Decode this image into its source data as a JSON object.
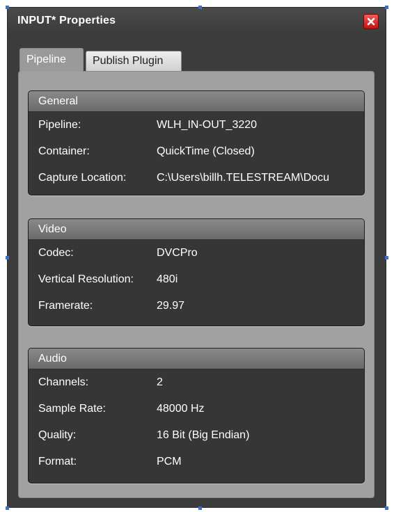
{
  "window": {
    "title": "INPUT* Properties"
  },
  "tabs": [
    {
      "label": "Pipeline",
      "active": true
    },
    {
      "label": "Publish Plugin",
      "active": false
    }
  ],
  "groups": {
    "general": {
      "header": "General",
      "rows": [
        {
          "label": "Pipeline:",
          "value": "WLH_IN-OUT_3220"
        },
        {
          "label": "Container:",
          "value": "QuickTime (Closed)"
        },
        {
          "label": "Capture Location:",
          "value": "C:\\Users\\billh.TELESTREAM\\Docu"
        }
      ]
    },
    "video": {
      "header": "Video",
      "rows": [
        {
          "label": "Codec:",
          "value": "DVCPro"
        },
        {
          "label": "Vertical Resolution:",
          "value": "480i"
        },
        {
          "label": "Framerate:",
          "value": "29.97"
        }
      ]
    },
    "audio": {
      "header": "Audio",
      "rows": [
        {
          "label": "Channels:",
          "value": "2"
        },
        {
          "label": "Sample Rate:",
          "value": "48000 Hz"
        },
        {
          "label": "Quality:",
          "value": "16 Bit (Big Endian)"
        },
        {
          "label": "Format:",
          "value": "PCM"
        }
      ]
    }
  },
  "icons": {
    "close": "close-icon"
  },
  "colors": {
    "window_bg": "#3c3c3c",
    "panel_bg": "#a1a1a1",
    "group_bg": "#363636",
    "close_red": "#d41d1d",
    "selection_handle": "#3d6fd1"
  }
}
